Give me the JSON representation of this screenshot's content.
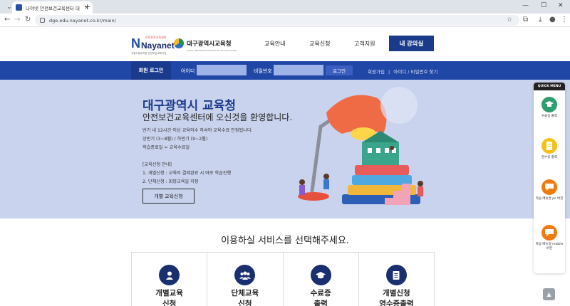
{
  "browser": {
    "tab_title": "나야넷 안전보건교육센터 대",
    "url": "dge.edu.nayanet.co.kr/main/"
  },
  "header": {
    "logo_name": "Nayanet",
    "logo_top": "안전보건교육센터",
    "logo_sub": "고용노동부지정 안전보건교육기관",
    "partner_name": "대구광역시교육청",
    "partner_en": "DAEGU METROPOLITAN OFFICE OF EDUCATION",
    "nav": [
      "교육안내",
      "교육신청",
      "고객지원"
    ],
    "my_class_label": "내 강의실"
  },
  "login": {
    "title": "회원 로그인",
    "id_label": "아이디",
    "pw_label": "비밀번호",
    "button": "로그인",
    "signup": "회원가입",
    "find": "아이디 / 비밀번호 찾기",
    "separator": "|"
  },
  "hero": {
    "title": "대구광역시 교육청",
    "subtitle": "안전보건교육센터에 오신것을 환영합니다.",
    "lines": [
      "반기 내 12시간 이상 교육이수 하셔야 교육수료 인정됩니다.",
      "상반기 (3~8월) / 하반기 (9~2월)",
      "학습종료일 = 교육수료일",
      "[교육신청 안내]",
      "1. 개별신청 : 교육비 결제완료 시 바로 학습진행",
      "2. 단체신청 : 희망교육일 지정"
    ],
    "button": "개별 교육신청"
  },
  "quick_menu": {
    "title": "QUICK MENU",
    "items": [
      {
        "label": "수료증 출력",
        "color": "#2f9e6e",
        "icon": "graduation-cap-icon"
      },
      {
        "label": "영수증 출력",
        "color": "#f2c21b",
        "icon": "receipt-icon"
      },
      {
        "label": "학습 매뉴얼 pc 버전",
        "color": "#f07a10",
        "icon": "chat-icon"
      },
      {
        "label": "학습 매뉴얼 mobile 버전",
        "color": "#f07a10",
        "icon": "chat-icon"
      }
    ]
  },
  "services": {
    "title": "이용하실 서비스를 선택해주세요.",
    "cards": [
      {
        "label": "개별교육\n신청",
        "icon": "person-icon"
      },
      {
        "label": "단체교육\n신청",
        "icon": "group-icon"
      },
      {
        "label": "수료증\n출력",
        "icon": "graduation-cap-icon"
      },
      {
        "label": "개별신청\n영수증출력",
        "icon": "document-icon"
      }
    ]
  },
  "colors": {
    "primary": "#1a3a8c",
    "login_bar": "#2046a6",
    "hero_bg": "#c9d3ed"
  }
}
